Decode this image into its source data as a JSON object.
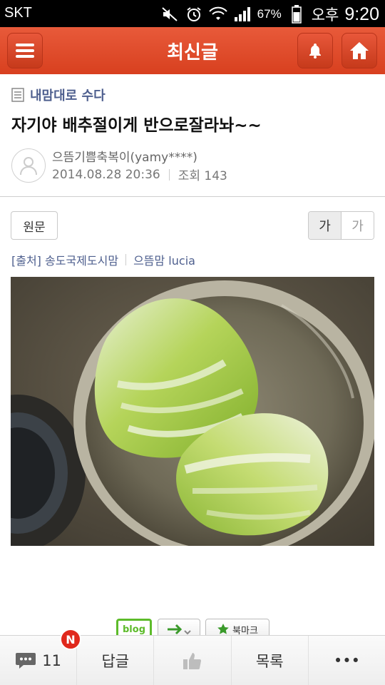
{
  "status_bar": {
    "carrier": "SKT",
    "battery_percent": "67%",
    "ampm": "오후",
    "time": "9:20"
  },
  "header": {
    "title": "최신글"
  },
  "post": {
    "board": "내맘대로 수다",
    "title": "자기야 배추절이게 반으로잘라놔~~",
    "author": "으뜸기쁨축복이(yamy****)",
    "date": "2014.08.28 20:36",
    "views": "조회 143"
  },
  "controls": {
    "original_label": "원문",
    "font_large": "가",
    "font_small": "가"
  },
  "source": {
    "cafe": "[출처] 송도국제도시맘",
    "nickname": "으뜸맘 lucia"
  },
  "share": {
    "blog": "blog",
    "bookmark": "북마크"
  },
  "toolbar": {
    "comment_count": "11",
    "badge": "N",
    "reply_label": "답글",
    "list_label": "목록",
    "more_label": "•••"
  },
  "colors": {
    "accent": "#d8401f",
    "link": "#4e5f8e",
    "badge": "#e0281c"
  }
}
